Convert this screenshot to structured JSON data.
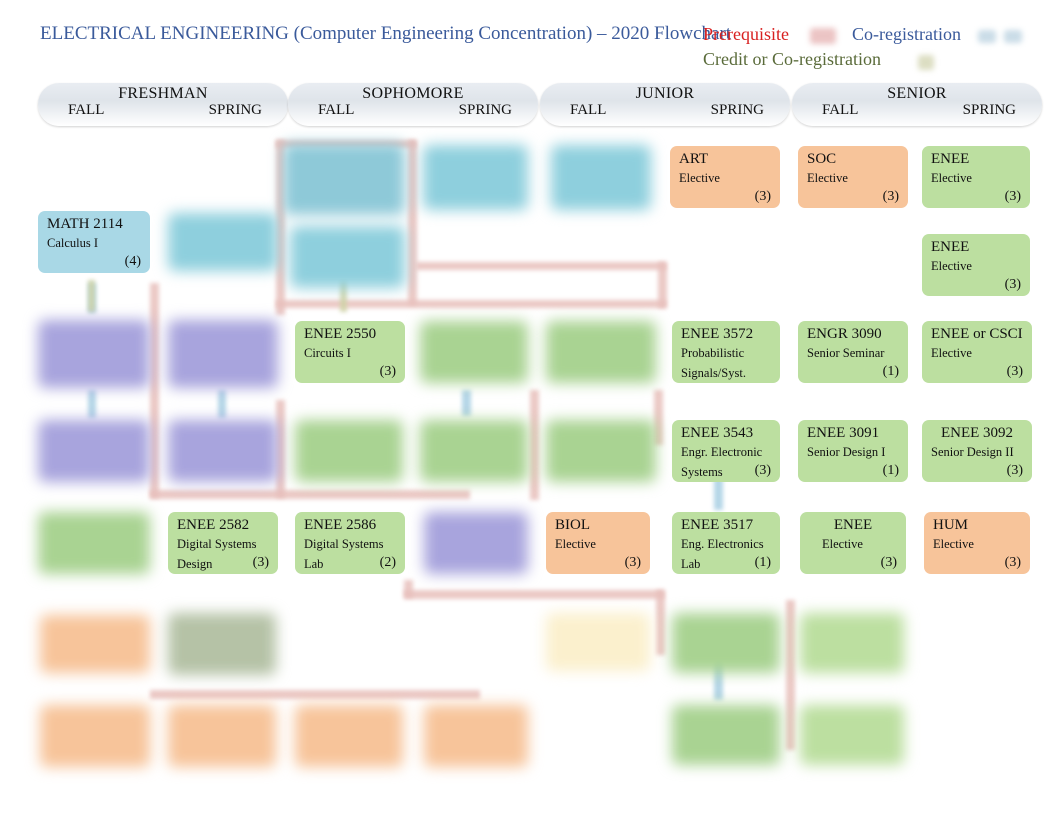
{
  "page": {
    "title": "ELECTRICAL ENGINEERING (Computer Engineering Concentration) – 2020 Flowchart"
  },
  "legend": {
    "prerequisite": "Prerequisite",
    "coregistration": "Co-registration",
    "credit_or_coregistration": "Credit or Co-registration",
    "colors": {
      "prerequisite": "#d82020",
      "coregistration": "#3a5a9b",
      "credit_or_coregistration": "#5a6b3a",
      "prerequisite_swatch": "#d98a8a",
      "coregistration_swatch": "#9fc0d4",
      "credit_swatch": "#b9bc86"
    }
  },
  "years": [
    {
      "name": "FRESHMAN",
      "fall": "FALL",
      "spring": "SPRING"
    },
    {
      "name": "SOPHOMORE",
      "fall": "FALL",
      "spring": "SPRING"
    },
    {
      "name": "JUNIOR",
      "fall": "FALL",
      "spring": "SPRING"
    },
    {
      "name": "SENIOR",
      "fall": "FALL",
      "spring": "SPRING"
    }
  ],
  "box_colors": {
    "blue": "#a9d8e6",
    "purple": "#b5b2e0",
    "green": "#bcdfa0",
    "orange": "#f7c49a",
    "cream": "#fbf0cd",
    "gray_green": "#b5c2a6"
  },
  "courses": [
    {
      "id": "c01",
      "code": "MATH 2114",
      "t1": "Calculus I",
      "t2": "",
      "credits": "(4)",
      "color": "blue",
      "blurred": false
    },
    {
      "id": "c02",
      "code": "",
      "t1": "",
      "t2": "",
      "credits": "",
      "color": "blue",
      "blurred": true
    },
    {
      "id": "c03",
      "code": "",
      "t1": "",
      "t2": "",
      "credits": "",
      "color": "blue",
      "blurred": true
    },
    {
      "id": "c04",
      "code": "",
      "t1": "",
      "t2": "",
      "credits": "",
      "color": "blue",
      "blurred": true
    },
    {
      "id": "c05",
      "code": "",
      "t1": "",
      "t2": "",
      "credits": "",
      "color": "blue",
      "blurred": true
    },
    {
      "id": "c06",
      "code": "",
      "t1": "",
      "t2": "",
      "credits": "",
      "color": "blue",
      "blurred": true
    },
    {
      "id": "c07",
      "code": "ART",
      "t1": "Elective",
      "t2": "",
      "credits": "(3)",
      "color": "orange",
      "blurred": false
    },
    {
      "id": "c08",
      "code": "SOC",
      "t1": "Elective",
      "t2": "",
      "credits": "(3)",
      "color": "orange",
      "blurred": false
    },
    {
      "id": "c09",
      "code": "ENEE",
      "t1": "Elective",
      "t2": "",
      "credits": "(3)",
      "color": "green",
      "blurred": false
    },
    {
      "id": "c10",
      "code": "ENEE",
      "t1": "Elective",
      "t2": "",
      "credits": "(3)",
      "color": "green",
      "blurred": false
    },
    {
      "id": "c11",
      "code": "",
      "t1": "",
      "t2": "",
      "credits": "",
      "color": "purple",
      "blurred": true
    },
    {
      "id": "c12",
      "code": "",
      "t1": "",
      "t2": "",
      "credits": "",
      "color": "purple",
      "blurred": true
    },
    {
      "id": "c13",
      "code": "ENEE 2550",
      "t1": "Circuits I",
      "t2": "",
      "credits": "(3)",
      "color": "green",
      "blurred": false
    },
    {
      "id": "c14",
      "code": "",
      "t1": "",
      "t2": "",
      "credits": "",
      "color": "green",
      "blurred": true
    },
    {
      "id": "c15",
      "code": "",
      "t1": "",
      "t2": "",
      "credits": "",
      "color": "green",
      "blurred": true
    },
    {
      "id": "c16",
      "code": "ENEE 3572",
      "t1": "Probabilistic",
      "t2": "Signals/Syst.",
      "credits": "",
      "color": "green",
      "blurred": false
    },
    {
      "id": "c17",
      "code": "ENGR 3090",
      "t1": "Senior Seminar",
      "t2": "",
      "credits": "(1)",
      "color": "green",
      "blurred": false
    },
    {
      "id": "c18",
      "code": "ENEE or CSCI",
      "t1": "Elective",
      "t2": "",
      "credits": "(3)",
      "color": "green",
      "blurred": false
    },
    {
      "id": "c19",
      "code": "",
      "t1": "",
      "t2": "",
      "credits": "",
      "color": "purple",
      "blurred": true
    },
    {
      "id": "c20",
      "code": "",
      "t1": "",
      "t2": "",
      "credits": "",
      "color": "purple",
      "blurred": true
    },
    {
      "id": "c21",
      "code": "",
      "t1": "",
      "t2": "",
      "credits": "",
      "color": "green",
      "blurred": true
    },
    {
      "id": "c22",
      "code": "",
      "t1": "",
      "t2": "",
      "credits": "",
      "color": "green",
      "blurred": true
    },
    {
      "id": "c23",
      "code": "",
      "t1": "",
      "t2": "",
      "credits": "",
      "color": "green",
      "blurred": true
    },
    {
      "id": "c24",
      "code": "ENEE 3543",
      "t1": "Engr. Electronic",
      "t2": "Systems",
      "credits": "(3)",
      "color": "green",
      "blurred": false
    },
    {
      "id": "c25",
      "code": "ENEE 3091",
      "t1": "Senior Design I",
      "t2": "",
      "credits": "(1)",
      "color": "green",
      "blurred": false
    },
    {
      "id": "c26",
      "code": "ENEE 3092",
      "t1": "Senior Design II",
      "t2": "",
      "credits": "(3)",
      "color": "green",
      "blurred": false
    },
    {
      "id": "c27",
      "code": "",
      "t1": "",
      "t2": "",
      "credits": "",
      "color": "green",
      "blurred": true
    },
    {
      "id": "c28",
      "code": "ENEE 2582",
      "t1": "Digital Systems",
      "t2": "Design",
      "credits": "(3)",
      "color": "green",
      "blurred": false
    },
    {
      "id": "c29",
      "code": "ENEE 2586",
      "t1": "Digital Systems",
      "t2": "Lab",
      "credits": "(2)",
      "color": "green",
      "blurred": false
    },
    {
      "id": "c30",
      "code": "",
      "t1": "",
      "t2": "",
      "credits": "",
      "color": "purple",
      "blurred": true
    },
    {
      "id": "c31",
      "code": "BIOL",
      "t1": "Elective",
      "t2": "",
      "credits": "(3)",
      "color": "orange",
      "blurred": false
    },
    {
      "id": "c32",
      "code": "ENEE 3517",
      "t1": "Eng. Electronics",
      "t2": "Lab",
      "credits": "(1)",
      "color": "green",
      "blurred": false
    },
    {
      "id": "c33",
      "code": "ENEE",
      "t1": "Elective",
      "t2": "",
      "credits": "(3)",
      "color": "green",
      "blurred": false
    },
    {
      "id": "c34",
      "code": "HUM",
      "t1": "Elective",
      "t2": "",
      "credits": "(3)",
      "color": "orange",
      "blurred": false
    },
    {
      "id": "c35",
      "code": "",
      "t1": "",
      "t2": "",
      "credits": "",
      "color": "orange",
      "blurred": true
    },
    {
      "id": "c36",
      "code": "",
      "t1": "",
      "t2": "",
      "credits": "",
      "color": "gray_green",
      "blurred": true
    },
    {
      "id": "c37",
      "code": "",
      "t1": "",
      "t2": "",
      "credits": "",
      "color": "cream",
      "blurred": true
    },
    {
      "id": "c38",
      "code": "",
      "t1": "",
      "t2": "",
      "credits": "",
      "color": "green",
      "blurred": true
    },
    {
      "id": "c39",
      "code": "",
      "t1": "",
      "t2": "",
      "credits": "",
      "color": "green",
      "blurred": true
    },
    {
      "id": "c40",
      "code": "",
      "t1": "",
      "t2": "",
      "credits": "",
      "color": "orange",
      "blurred": true
    },
    {
      "id": "c41",
      "code": "",
      "t1": "",
      "t2": "",
      "credits": "",
      "color": "orange",
      "blurred": true
    },
    {
      "id": "c42",
      "code": "",
      "t1": "",
      "t2": "",
      "credits": "",
      "color": "orange",
      "blurred": true
    },
    {
      "id": "c43",
      "code": "",
      "t1": "",
      "t2": "",
      "credits": "",
      "color": "orange",
      "blurred": true
    },
    {
      "id": "c44",
      "code": "",
      "t1": "",
      "t2": "",
      "credits": "",
      "color": "green",
      "blurred": true
    },
    {
      "id": "c45",
      "code": "",
      "t1": "",
      "t2": "",
      "credits": "",
      "color": "green",
      "blurred": true
    }
  ]
}
